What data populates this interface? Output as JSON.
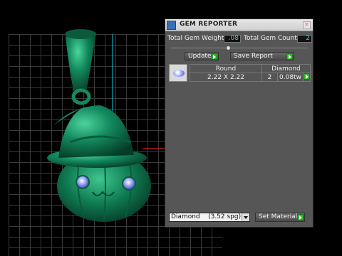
{
  "panel": {
    "title": "GEM REPORTER",
    "close_label": "×",
    "total_weight_label": "Total Gem Weight",
    "total_weight_value": ".08",
    "total_count_label": "Total Gem Count",
    "total_count_value": "2",
    "update_label": "Update",
    "save_report_label": "Save Report",
    "table": {
      "headers": [
        "Round",
        "Diamond"
      ],
      "row": {
        "size": "2.22 X 2.22",
        "count": "2",
        "weight": "0.08tw"
      }
    },
    "material_select": "Diamond    (3.52 spg)",
    "set_material_label": "Set Material"
  },
  "colors": {
    "value_text": "#2bd3ff",
    "go_button": "#2fb52f",
    "model": "#10714f"
  },
  "icons": [
    "gem-reporter-app-icon",
    "close-icon",
    "play-arrow-icon",
    "gem-thumbnail-icon",
    "dropdown-arrow-icon"
  ]
}
